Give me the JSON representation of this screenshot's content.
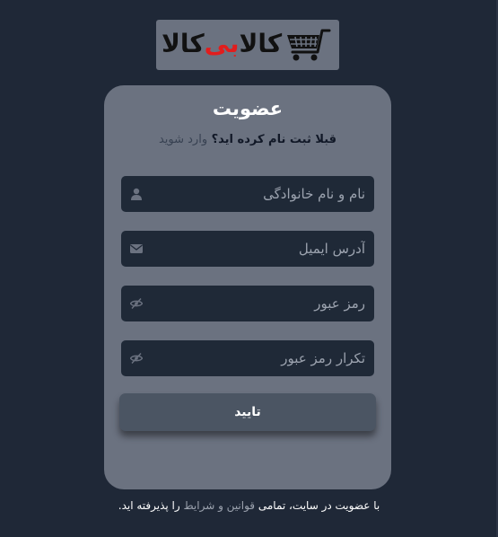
{
  "logo": {
    "text_prefix": "کالا",
    "text_accent": "بی",
    "text_suffix": "کالا",
    "accent_color": "#e11d1d",
    "icon": "shopping-cart-icon"
  },
  "signup": {
    "title": "عضویت",
    "already_registered": "قبلا ثبت نام کرده اید؟",
    "login_link": "وارد شوید",
    "fields": [
      {
        "placeholder": "نام و نام خانوادگی",
        "icon": "user-icon"
      },
      {
        "placeholder": "آدرس ایمیل",
        "icon": "envelope-icon"
      },
      {
        "placeholder": "رمز عبور",
        "icon": "eye-slash-icon"
      },
      {
        "placeholder": "تکرار رمز عبور",
        "icon": "eye-slash-icon"
      }
    ],
    "submit_label": "تایید"
  },
  "footer": {
    "text_before": "با عضویت در سایت، تمامی",
    "terms_link": "قوانین و شرایط",
    "text_after": "را پذیرفته اید."
  },
  "colors": {
    "page_background": "#1f2837",
    "card_background": "#6b7280",
    "field_background": "#1f2937",
    "button_background": "#4b5563"
  }
}
